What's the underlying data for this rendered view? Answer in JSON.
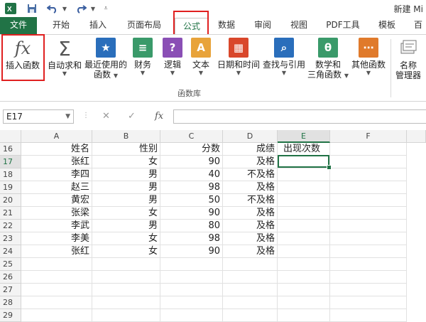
{
  "titlebar": {
    "title": "新建 Mi"
  },
  "tabs": [
    "文件",
    "开始",
    "插入",
    "页面布局",
    "公式",
    "数据",
    "审阅",
    "视图",
    "PDF工具",
    "模板",
    "百"
  ],
  "ribbon": {
    "buttons": [
      {
        "label": "插入函数",
        "icon": "fx-icon"
      },
      {
        "label": "自动求和",
        "icon": "sigma-icon"
      },
      {
        "label": "最近使用的",
        "label2": "函数",
        "icon": "star-book-icon"
      },
      {
        "label": "财务",
        "icon": "coins-book-icon"
      },
      {
        "label": "逻辑",
        "icon": "question-book-icon"
      },
      {
        "label": "文本",
        "icon": "text-book-icon"
      },
      {
        "label": "日期和时间",
        "icon": "calendar-book-icon"
      },
      {
        "label": "查找与引用",
        "icon": "search-book-icon"
      },
      {
        "label": "数学和",
        "label2": "三角函数",
        "icon": "theta-book-icon"
      },
      {
        "label": "其他函数",
        "icon": "more-book-icon"
      },
      {
        "label": "名称",
        "label2": "管理器",
        "icon": "name-manager-icon"
      }
    ],
    "group_label": "函数库",
    "icon_glyphs": {
      "fx": "fx",
      "sigma": "Σ",
      "star": "★",
      "coins": "≡",
      "question": "?",
      "text": "A",
      "calendar": "▦",
      "search": "⌕",
      "theta": "θ",
      "more": "⋯"
    },
    "colors": {
      "star": "#2a6ebb",
      "coins": "#3a9a6a",
      "question": "#8a4fb5",
      "text": "#e8a33a",
      "calendar": "#d9472b",
      "search": "#2a6ebb",
      "theta": "#3a9a6a",
      "more": "#e07a2b"
    }
  },
  "formula_bar": {
    "name_box": "E17",
    "fx_label": "fx",
    "cancel": "✕",
    "enter": "✓",
    "content": ""
  },
  "sheet": {
    "columns": [
      "A",
      "B",
      "C",
      "D",
      "E",
      "F"
    ],
    "rows": [
      {
        "num": "16",
        "cells": [
          "姓名",
          "性别",
          "分数",
          "成绩",
          "出现次数",
          ""
        ]
      },
      {
        "num": "17",
        "cells": [
          "张红",
          "女",
          "90",
          "及格",
          "",
          ""
        ]
      },
      {
        "num": "18",
        "cells": [
          "李四",
          "男",
          "40",
          "不及格",
          "",
          ""
        ]
      },
      {
        "num": "19",
        "cells": [
          "赵三",
          "男",
          "98",
          "及格",
          "",
          ""
        ]
      },
      {
        "num": "20",
        "cells": [
          "黄宏",
          "男",
          "50",
          "不及格",
          "",
          ""
        ]
      },
      {
        "num": "21",
        "cells": [
          "张梁",
          "女",
          "90",
          "及格",
          "",
          ""
        ]
      },
      {
        "num": "22",
        "cells": [
          "李武",
          "男",
          "80",
          "及格",
          "",
          ""
        ]
      },
      {
        "num": "23",
        "cells": [
          "李美",
          "女",
          "98",
          "及格",
          "",
          ""
        ]
      },
      {
        "num": "24",
        "cells": [
          "张红",
          "女",
          "90",
          "及格",
          "",
          ""
        ]
      },
      {
        "num": "25",
        "cells": [
          "",
          "",
          "",
          "",
          "",
          ""
        ]
      },
      {
        "num": "26",
        "cells": [
          "",
          "",
          "",
          "",
          "",
          ""
        ]
      },
      {
        "num": "27",
        "cells": [
          "",
          "",
          "",
          "",
          "",
          ""
        ]
      },
      {
        "num": "28",
        "cells": [
          "",
          "",
          "",
          "",
          "",
          ""
        ]
      },
      {
        "num": "29",
        "cells": [
          "",
          "",
          "",
          "",
          "",
          ""
        ]
      }
    ],
    "selected_cell": "E17",
    "accent": "#217346"
  },
  "highlight_color": "#e02020"
}
